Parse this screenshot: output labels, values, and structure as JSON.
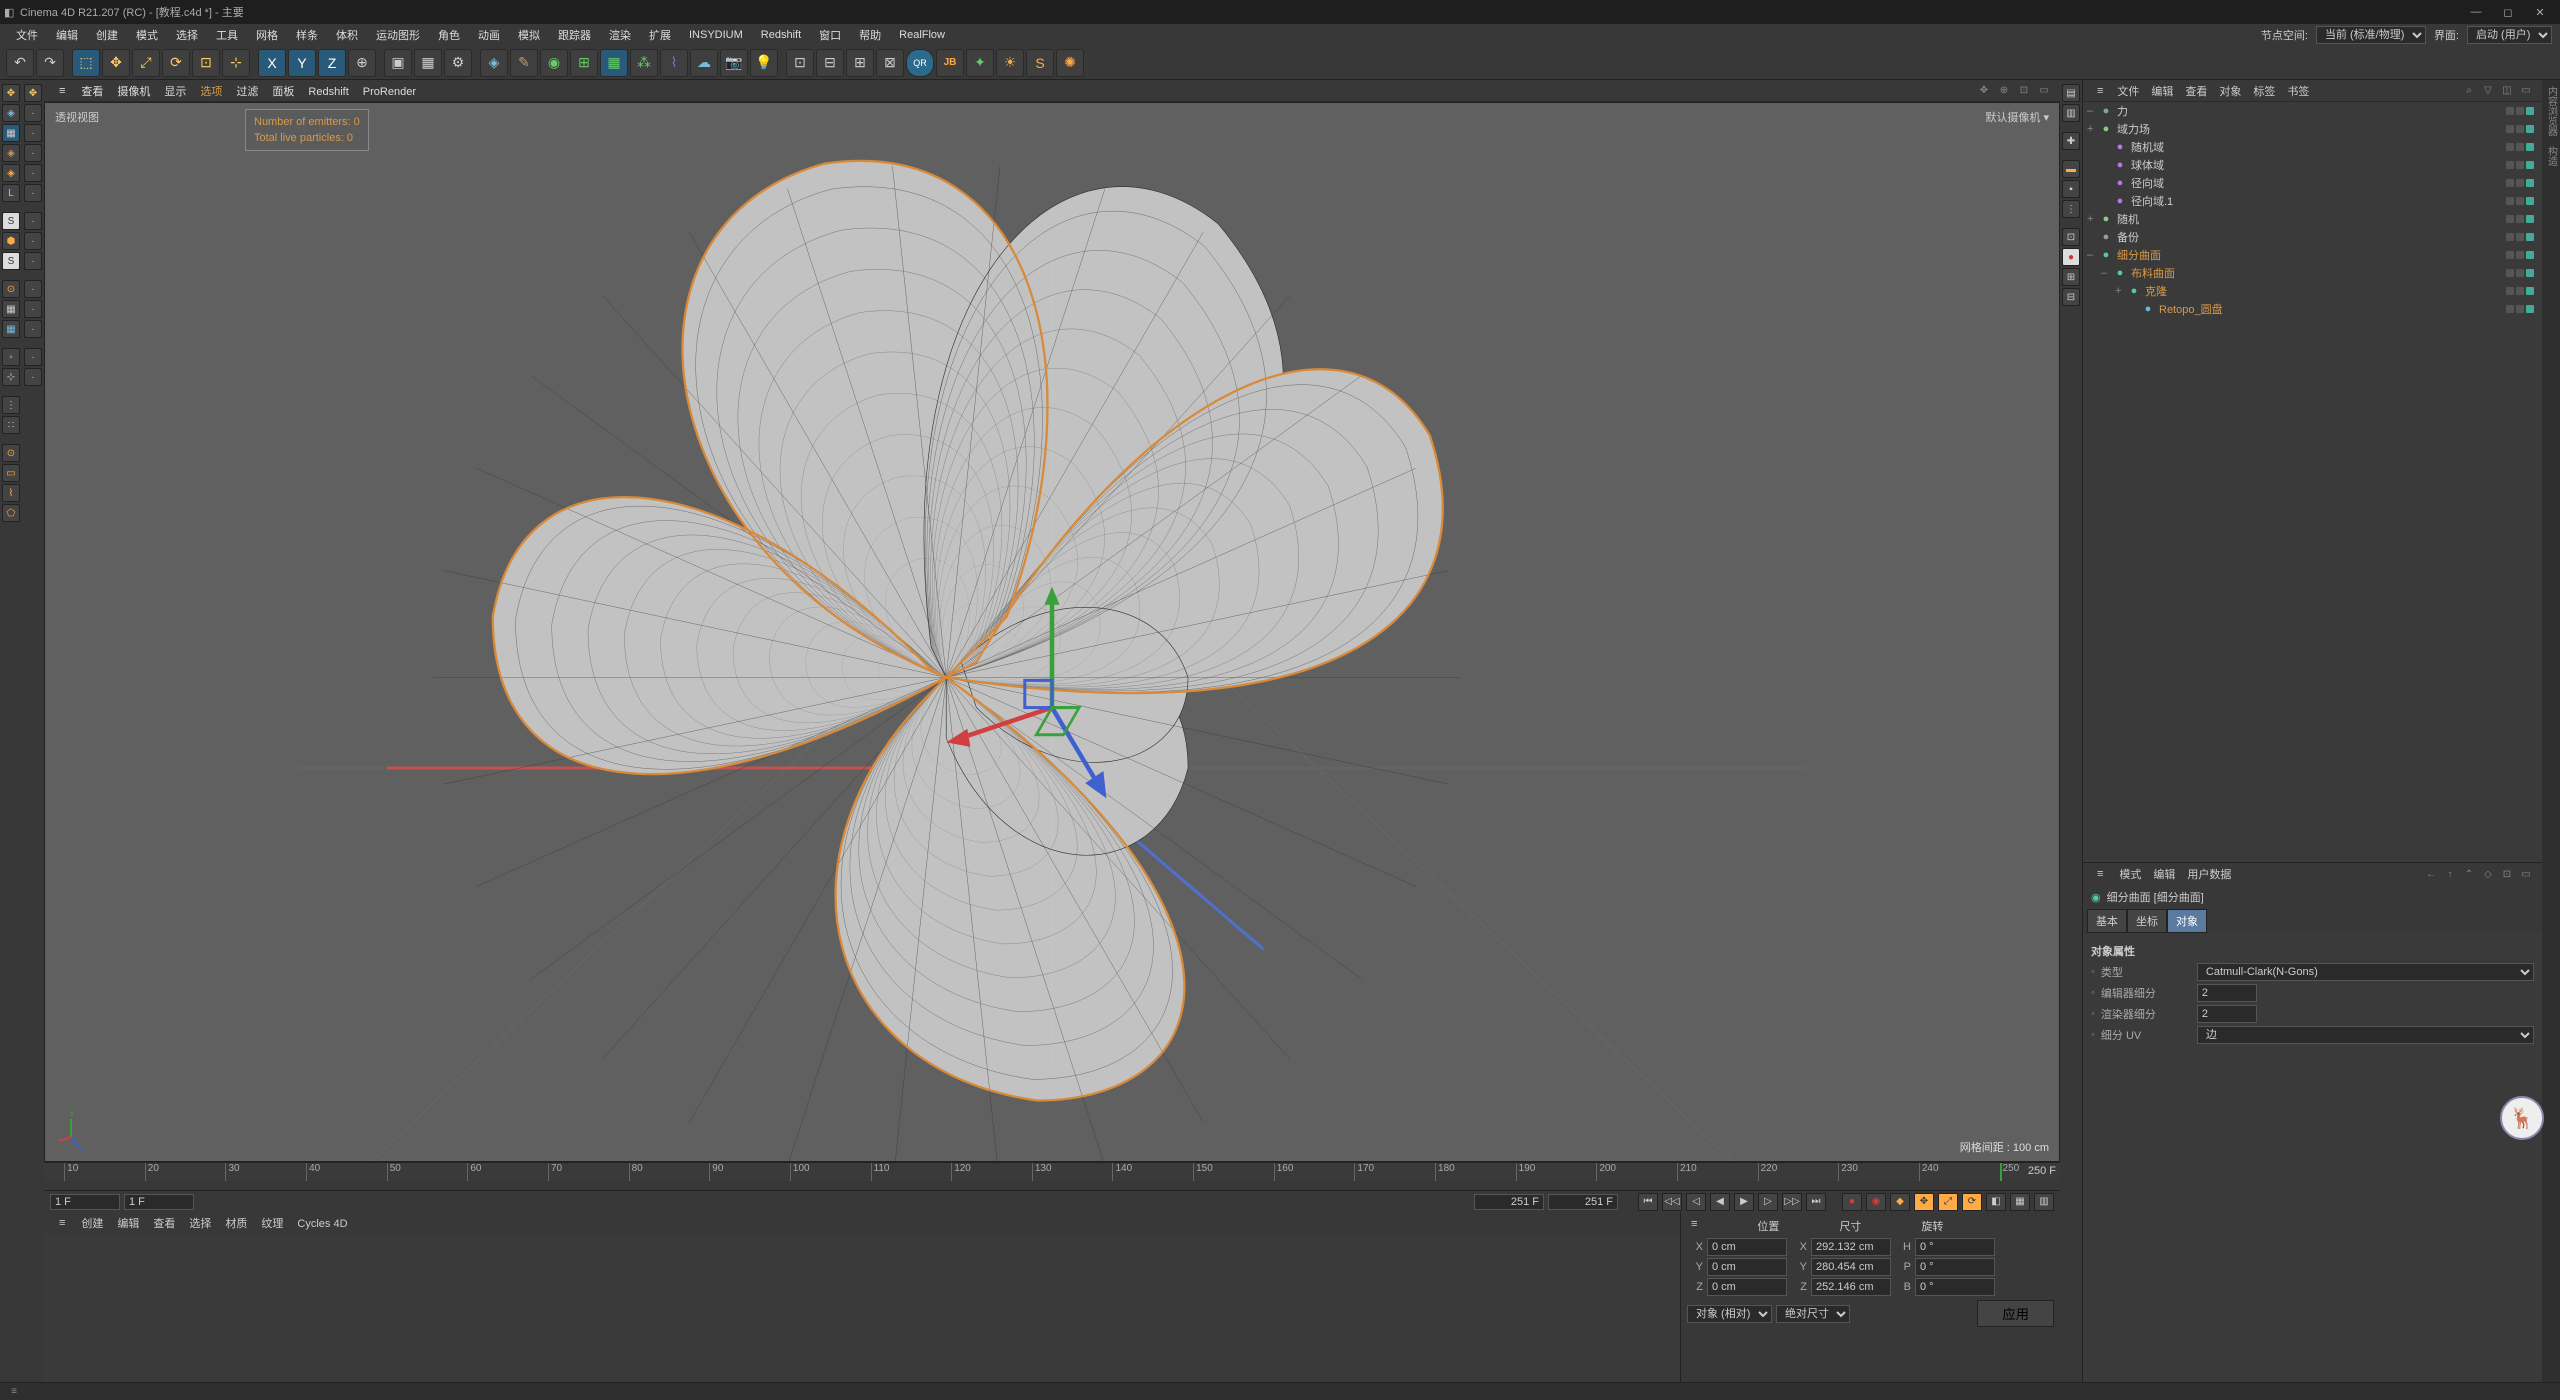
{
  "title": "Cinema 4D R21.207 (RC) - [教程.c4d *] - 主要",
  "menus": [
    "文件",
    "编辑",
    "创建",
    "模式",
    "选择",
    "工具",
    "网格",
    "样条",
    "体积",
    "运动图形",
    "角色",
    "动画",
    "模拟",
    "跟踪器",
    "渲染",
    "扩展",
    "INSYDIUM",
    "Redshift",
    "窗口",
    "帮助",
    "RealFlow"
  ],
  "nodeSpaceLabel": "节点空间:",
  "nodeSpaceValue": "当前 (标准/物理)",
  "layoutLabel": "界面:",
  "layoutValue": "启动 (用户)",
  "vpMenus": [
    "查看",
    "摄像机",
    "显示",
    "选项",
    "过滤",
    "面板",
    "Redshift",
    "ProRender"
  ],
  "vpLabelTL": "透视视图",
  "vpCamera": "默认摄像机",
  "simEmitters": "Number of emitters: 0",
  "simParticles": "Total live particles: 0",
  "gridInfo": "网格间距 : 100 cm",
  "timeline": {
    "start": 10,
    "end": 250,
    "step": 10,
    "current": 250,
    "field1": "1 F",
    "field2": "1 F",
    "field3": "251 F",
    "field4": "251 F",
    "endLabel": "250 F"
  },
  "materialMenus": [
    "创建",
    "编辑",
    "查看",
    "选择",
    "材质",
    "纹理",
    "Cycles 4D"
  ],
  "coords": {
    "hdr": [
      "位置",
      "尺寸",
      "旋转"
    ],
    "rows": [
      {
        "axis": "X",
        "p": "0 cm",
        "s": "292.132 cm",
        "r": "H",
        "rv": "0 °"
      },
      {
        "axis": "Y",
        "p": "0 cm",
        "s": "280.454 cm",
        "r": "P",
        "rv": "0 °"
      },
      {
        "axis": "Z",
        "p": "0 cm",
        "s": "252.146 cm",
        "r": "B",
        "rv": "0 °"
      }
    ],
    "mode1": "对象 (相对)",
    "mode2": "绝对尺寸",
    "apply": "应用"
  },
  "omMenus": [
    "文件",
    "编辑",
    "查看",
    "对象",
    "标签",
    "书签"
  ],
  "omTree": [
    {
      "indent": 0,
      "exp": "–",
      "icon": "#7aa",
      "name": "力",
      "sel": false
    },
    {
      "indent": 0,
      "exp": "+",
      "icon": "#8c8",
      "name": "域力场",
      "sel": false
    },
    {
      "indent": 1,
      "exp": "",
      "icon": "#b7d",
      "name": "随机域",
      "sel": false
    },
    {
      "indent": 1,
      "exp": "",
      "icon": "#b7d",
      "name": "球体域",
      "sel": false
    },
    {
      "indent": 1,
      "exp": "",
      "icon": "#b7d",
      "name": "径向域",
      "sel": false
    },
    {
      "indent": 1,
      "exp": "",
      "icon": "#b7d",
      "name": "径向域.1",
      "sel": false
    },
    {
      "indent": 0,
      "exp": "+",
      "icon": "#8c8",
      "name": "随机",
      "sel": false
    },
    {
      "indent": 0,
      "exp": "",
      "icon": "#999",
      "name": "备份",
      "sel": false
    },
    {
      "indent": 0,
      "exp": "–",
      "icon": "#5c9",
      "name": "细分曲面",
      "sel": true
    },
    {
      "indent": 1,
      "exp": "–",
      "icon": "#5c9",
      "name": "布料曲面",
      "sel": true
    },
    {
      "indent": 2,
      "exp": "+",
      "icon": "#5c9",
      "name": "克隆",
      "sel": true
    },
    {
      "indent": 3,
      "exp": "",
      "icon": "#6bd",
      "name": "Retopo_圆盘",
      "sel": true
    }
  ],
  "inspMenus": [
    "模式",
    "编辑",
    "用户数据"
  ],
  "inspTitle": "细分曲面 [细分曲面]",
  "inspTabs": [
    "基本",
    "坐标",
    "对象"
  ],
  "inspActiveTab": 2,
  "inspSection": "对象属性",
  "inspRows": [
    {
      "label": "类型",
      "type": "select",
      "value": "Catmull-Clark(N-Gons)"
    },
    {
      "label": "编辑器细分",
      "type": "num",
      "value": "2"
    },
    {
      "label": "渲染器细分",
      "type": "num",
      "value": "2"
    },
    {
      "label": "细分 UV",
      "type": "select",
      "value": "边"
    }
  ]
}
